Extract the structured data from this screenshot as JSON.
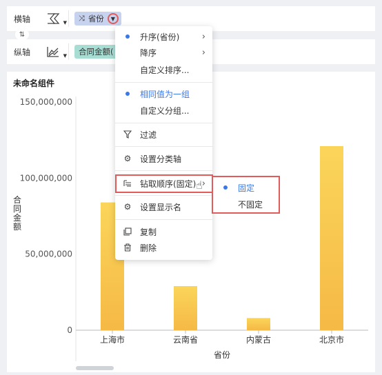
{
  "axes": {
    "x_label": "横轴",
    "x_field": "省份",
    "y_label": "纵轴",
    "y_field": "合同金额("
  },
  "component": {
    "title": "未命名组件"
  },
  "menu": {
    "items": [
      {
        "label": "升序(省份)",
        "dot": true,
        "arrow": true,
        "active": false
      },
      {
        "label": "降序",
        "dot": false,
        "arrow": true,
        "active": false
      },
      {
        "label": "自定义排序...",
        "dot": false,
        "arrow": false,
        "active": false
      },
      {
        "label": "相同值为一组",
        "dot": true,
        "arrow": false,
        "active": true
      },
      {
        "label": "自定义分组...",
        "dot": false,
        "arrow": false,
        "active": false
      },
      {
        "label": "过滤",
        "icon": "filter-icon"
      },
      {
        "label": "设置分类轴",
        "icon": "gear-icon"
      },
      {
        "label": "钻取顺序(固定)",
        "icon": "drill-icon",
        "arrow": true
      },
      {
        "label": "设置显示名",
        "icon": "gear-icon"
      },
      {
        "label": "复制",
        "icon": "copy-icon"
      },
      {
        "label": "删除",
        "icon": "trash-icon"
      }
    ]
  },
  "submenu": {
    "items": [
      {
        "label": "固定",
        "active": true
      },
      {
        "label": "不固定",
        "active": false
      }
    ]
  },
  "chart_data": {
    "type": "bar",
    "categories": [
      "上海市",
      "云南省",
      "内蒙古",
      "北京市"
    ],
    "values": [
      84000000,
      29000000,
      8000000,
      121000000
    ],
    "xlabel": "省份",
    "ylabel": "合同金额",
    "ylim": [
      0,
      150000000
    ],
    "yticks": [
      "0",
      "50,000,000",
      "100,000,000",
      "150,000,000"
    ],
    "bar_color_top": "#fbd55a",
    "bar_color_bottom": "#f5b945"
  },
  "colors": {
    "accent": "#3a78e7",
    "highlight": "#e35a5a"
  }
}
